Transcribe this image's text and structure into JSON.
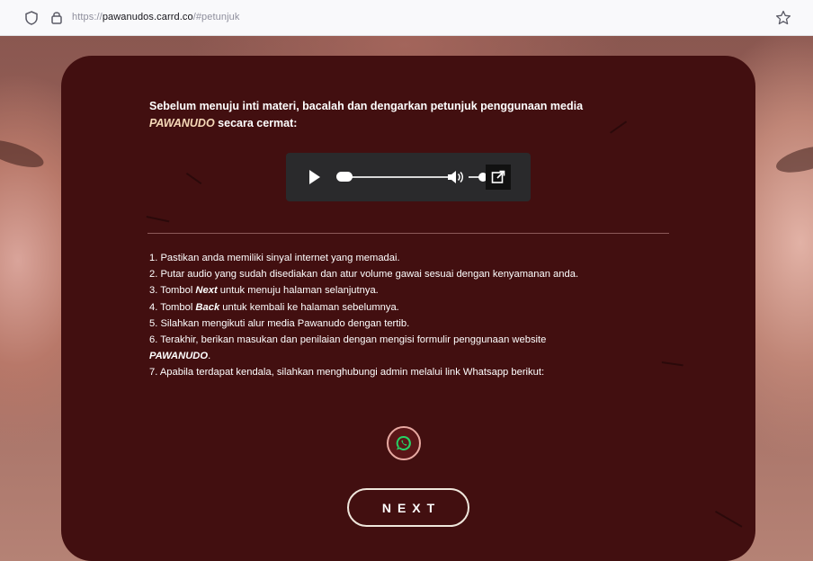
{
  "browser": {
    "url_prefix": "https://",
    "url_domain": "pawanudos.carrd.co",
    "url_hash": "/#petunjuk"
  },
  "card": {
    "intro_line1": "Sebelum menuju inti materi, bacalah dan dengarkan petunjuk penggunaan media",
    "intro_brand": "PAWANUDO",
    "intro_line2": " secara cermat:",
    "steps": [
      {
        "pre": "1. Pastikan anda memiliki sinyal internet yang memadai.",
        "em": "",
        "post": ""
      },
      {
        "pre": "2. Putar audio yang sudah disediakan dan atur volume gawai sesuai dengan kenyamanan anda.",
        "em": "",
        "post": ""
      },
      {
        "pre": "3. Tombol ",
        "em": "Next",
        "post": " untuk menuju halaman selanjutnya."
      },
      {
        "pre": "4. Tombol ",
        "em": "Back",
        "post": " untuk kembali ke halaman sebelumnya."
      },
      {
        "pre": "5. Silahkan mengikuti alur media Pawanudo dengan tertib.",
        "em": "",
        "post": ""
      },
      {
        "pre": "6. Terakhir, berikan masukan dan penilaian dengan mengisi formulir penggunaan website",
        "em": "",
        "post": ""
      },
      {
        "pre": "",
        "em": "PAWANUDO",
        "post": "."
      },
      {
        "pre": "7. Apabila terdapat kendala, silahkan menghubungi admin melalui link Whatsapp berikut:",
        "em": "",
        "post": ""
      }
    ],
    "next_label": "NEXT"
  },
  "audio": {
    "progress": 0.0,
    "volume": 0.5
  },
  "icons": {
    "shield": "tracking-shield-icon",
    "lock": "lock-icon",
    "star": "bookmark-star-icon",
    "play": "play-icon",
    "volume": "volume-icon",
    "popout": "popout-icon",
    "whatsapp": "whatsapp-icon"
  },
  "colors": {
    "card_bg": "#420f10",
    "accent_brand": "#f6d9b8",
    "whatsapp_green": "#25d366"
  }
}
